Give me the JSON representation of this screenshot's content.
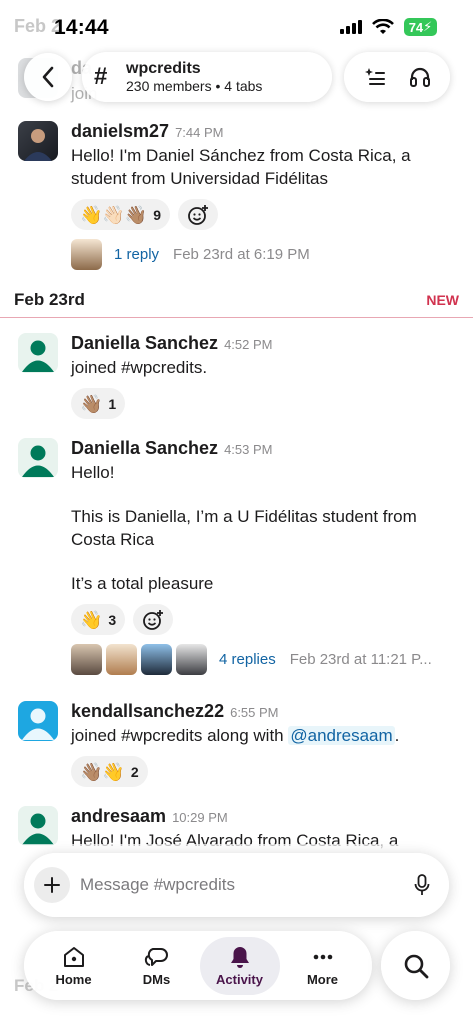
{
  "status_bar": {
    "time": "14:44",
    "battery": "74",
    "ghost_date": "Feb 2"
  },
  "header": {
    "channel_name": "wpcredits",
    "channel_meta": "230 members • 4 tabs",
    "ghost_author": "da",
    "ghost_text": "join"
  },
  "messages": [
    {
      "author": "danielsm27",
      "time": "7:44 PM",
      "text": "Hello! I'm Daniel Sánchez from Costa Rica, a student from Universidad Fidélitas",
      "reactions": [
        {
          "emoji": "👋👋🏻👋🏽",
          "count": "9"
        }
      ],
      "thread": {
        "replies": "1 reply",
        "last": "Feb 23rd at 6:19 PM"
      }
    },
    {
      "author": "Daniella Sanchez",
      "time": "4:52 PM",
      "text": "joined #wpcredits.",
      "reactions": [
        {
          "emoji": "👋🏽",
          "count": "1"
        }
      ]
    },
    {
      "author": "Daniella Sanchez",
      "time": "4:53 PM",
      "text_lines": [
        "Hello!",
        "This is Daniella, I’m a U Fidélitas student from Costa Rica",
        "It’s a total pleasure"
      ],
      "reactions": [
        {
          "emoji": "👋",
          "count": "3"
        }
      ],
      "thread": {
        "replies": "4 replies",
        "last": "Feb 23rd at 11:21 P..."
      }
    },
    {
      "author": "kendallsanchez22",
      "time": "6:55 PM",
      "text_prefix": "joined #wpcredits along with ",
      "mention": "@andresaam",
      "text_suffix": ".",
      "reactions": [
        {
          "emoji": "👋🏽👋",
          "count": "2"
        }
      ]
    },
    {
      "author": "andresaam",
      "time": "10:29 PM",
      "text": "Hello! I'm José Alvarado  from Costa Rica, a"
    }
  ],
  "day_divider": {
    "label": "Feb 23rd",
    "new_label": "NEW"
  },
  "composer": {
    "placeholder": "Message #wpcredits"
  },
  "nav": {
    "home": "Home",
    "dms": "DMs",
    "activity": "Activity",
    "more": "More"
  },
  "ghost_bottom": "Feb 2",
  "colors": {
    "link": "#1264a3",
    "new": "#d1334f",
    "brand": "#4a154b",
    "online": "#007a5a"
  }
}
